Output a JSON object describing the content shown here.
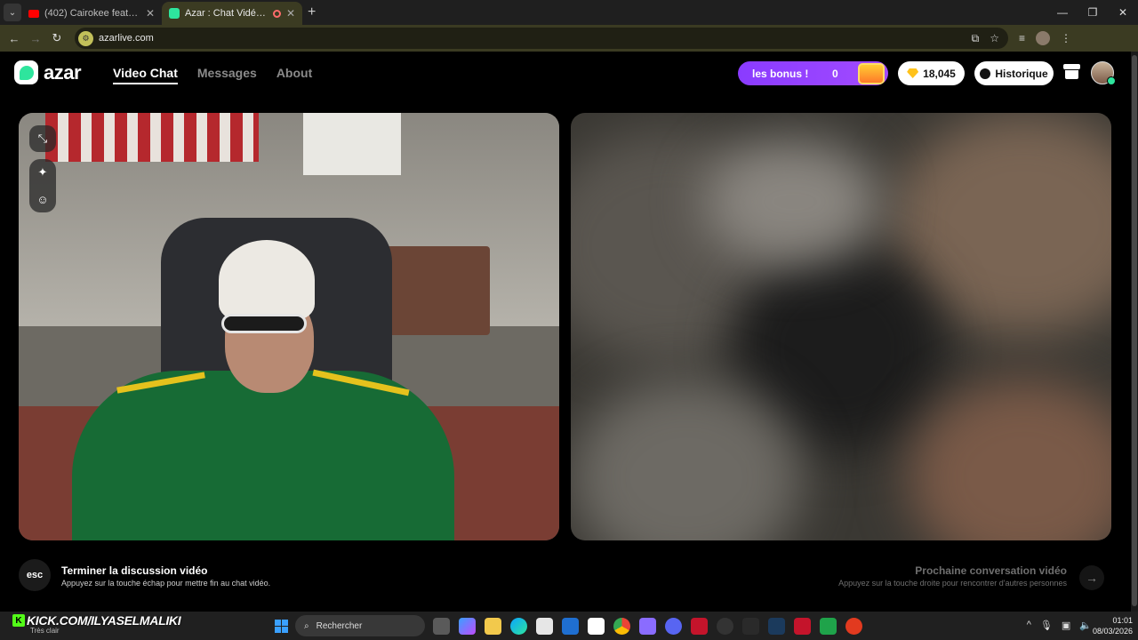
{
  "browser": {
    "tabs": [
      {
        "title": "(402) Cairokee feat. Tarek El-Sh",
        "active": false
      },
      {
        "title": "Azar : Chat Vidéo avec de n",
        "active": true
      }
    ],
    "new_tab": "+",
    "url": "azarlive.com"
  },
  "app": {
    "logo": "azar",
    "nav": [
      {
        "label": "Video Chat",
        "active": true
      },
      {
        "label": "Messages",
        "active": false
      },
      {
        "label": "About",
        "active": false
      }
    ],
    "bonus": {
      "label": "les bonus !",
      "count": "0"
    },
    "gems": "18,045",
    "history_label": "Historique"
  },
  "bottom": {
    "esc_key": "esc",
    "end_title": "Terminer la discussion vidéo",
    "end_subtitle": "Appuyez sur la touche échap pour mettre fin au chat vidéo.",
    "next_title": "Prochaine conversation vidéo",
    "next_subtitle": "Appuyez sur la touche droite pour rencontrer d'autres personnes"
  },
  "taskbar": {
    "overlay_text": "KICK.COM/ILYASELMALIKI",
    "weather": "Très clair",
    "search_placeholder": "Rechercher",
    "time": "01:01",
    "date": "08/03/2026"
  },
  "colors": {
    "accent": "#2ee59d",
    "bonus": "#8a3bff",
    "tab_active": "#3b3b22"
  }
}
